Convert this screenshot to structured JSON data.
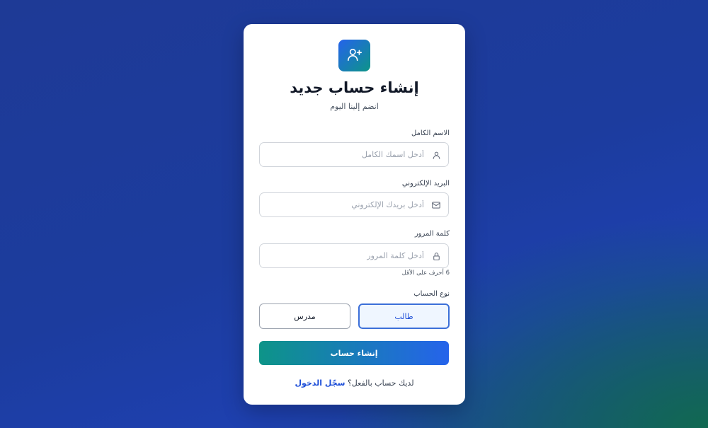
{
  "header": {
    "title": "إنشاء حساب جديد",
    "subtitle": "انضم إلينا اليوم",
    "logo_icon": "user-plus-icon"
  },
  "fields": {
    "full_name": {
      "label": "الاسم الكامل",
      "placeholder": "أدخل اسمك الكامل",
      "value": "",
      "icon": "user-icon"
    },
    "email": {
      "label": "البريد الإلكتروني",
      "placeholder": "أدخل بريدك الإلكتروني",
      "value": "",
      "icon": "mail-icon"
    },
    "password": {
      "label": "كلمة المرور",
      "placeholder": "أدخل كلمة المرور",
      "value": "",
      "icon": "lock-icon",
      "hint": "6 أحرف على الأقل"
    }
  },
  "account_type": {
    "label": "نوع الحساب",
    "options": [
      "طالب",
      "مدرس"
    ],
    "selected": "طالب"
  },
  "submit_label": "إنشاء حساب",
  "footer": {
    "prompt": "لديك حساب بالفعل؟",
    "link_label": "سجّل الدخول"
  },
  "colors": {
    "accent": "#2563eb",
    "accent_secondary": "#0d9488",
    "selected_border": "#3b6fd8",
    "selected_bg": "#eff6ff"
  }
}
